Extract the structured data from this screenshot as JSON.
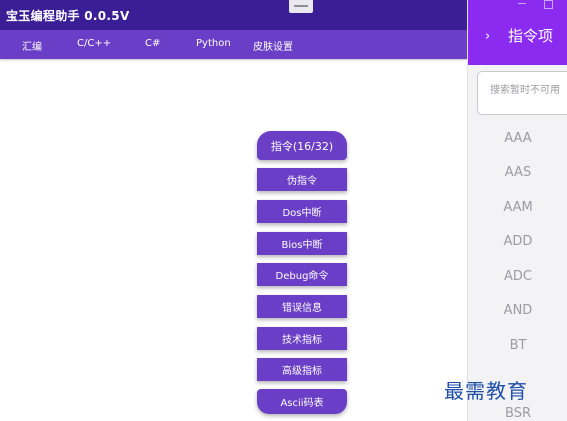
{
  "app": {
    "title": "宝玉编程助手   0.0.5V"
  },
  "menubar": {
    "items": [
      "汇编",
      "C/C++",
      "C#",
      "Python",
      "皮肤设置"
    ]
  },
  "center_menu": {
    "head_label": "指令(16/32)",
    "items": [
      "伪指令",
      "Dos中断",
      "Bios中断",
      "Debug命令",
      "错误信息",
      "技术指标",
      "高级指标"
    ],
    "tail_label": "Ascii码表"
  },
  "side_panel": {
    "title": "指令项",
    "search_placeholder": "搜索暂时不可用",
    "items": [
      "AAA",
      "AAS",
      "AAM",
      "ADD",
      "ADC",
      "AND",
      "BT",
      "BSR"
    ]
  },
  "watermark": "最需教育",
  "colors": {
    "titlebar": "#3b1e95",
    "menubar": "#6a3ec6",
    "side_header": "#8a2bef",
    "button": "#6a3ec6"
  }
}
